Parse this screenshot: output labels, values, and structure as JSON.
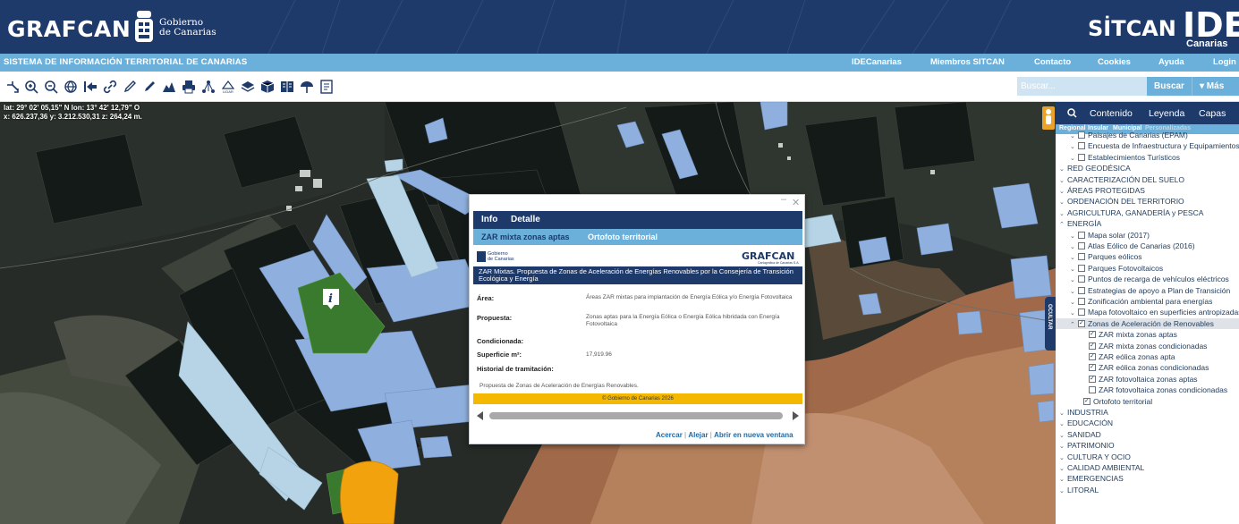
{
  "header": {
    "brand": "GRAFCAN",
    "gobierno": [
      "Gobierno",
      "de Canarias"
    ],
    "sitcan": "SİTCAN",
    "ide": "IDE",
    "ide_sub": "Canarias"
  },
  "navbar": {
    "system_title": "SISTEMA DE INFORMACIÓN TERRITORIAL DE CANARIAS",
    "links": [
      "IDECanarias",
      "Miembros SITCAN",
      "Contacto",
      "Cookies",
      "Ayuda",
      "Login"
    ]
  },
  "toolbar": {
    "icons": [
      "select-icon",
      "zoom-in-icon",
      "zoom-out-icon",
      "globe-icon",
      "back-icon",
      "link-icon",
      "pencil-icon",
      "ruler-icon",
      "profile-icon",
      "print-icon",
      "network-icon",
      "lidar-icon",
      "layers-icon",
      "3d-icon",
      "book-icon",
      "parachute-icon",
      "document-icon"
    ],
    "search_placeholder": "Buscar...",
    "search_button": "Buscar",
    "more_button": "▾ Más"
  },
  "map": {
    "coords_line1": "lat: 29° 02' 05,15\" N  lon: 13° 42' 12,79\" O",
    "coords_line2": "x: 626.237,36  y: 3.212.530,31  z: 264,24 m.",
    "ocultar": "OCULTAR"
  },
  "popup": {
    "tabs": [
      "Info",
      "Detalle"
    ],
    "sub_tabs": [
      "ZAR mixta zonas aptas",
      "Ortofoto territorial"
    ],
    "gob_small": [
      "Gobierno",
      "de Canarias"
    ],
    "grafcan": "GRAFCAN",
    "grafcan_sub": "Cartográfica de Canarias S.A.",
    "title": "ZAR Mixtas. Propuesta de Zonas de Aceleración de Energías Renovables por la Consejería de Transición Ecológica y Energía",
    "rows": [
      {
        "label": "Área:",
        "value": "Áreas ZAR mixtas para implantación de Energía Eólica y/o Energía Fotovoltaica"
      },
      {
        "label": "Propuesta:",
        "value": "Zonas aptas para la Energía Eólica o Energía Eólica hibridada con Energía Fotovoltaica"
      },
      {
        "label": "Condicionada:",
        "value": ""
      },
      {
        "label": "Superficie m²:",
        "value": "17,919.96"
      },
      {
        "label": "Historial de tramitación:",
        "value": ""
      }
    ],
    "historial_text": "Propuesta de Zonas de Aceleración de Energías Renovables.",
    "copyright": "© Gobierno de Canarias 2026",
    "links": [
      "Acercar",
      "Alejar",
      "Abrir en nueva ventana"
    ]
  },
  "sidebar": {
    "tabs": [
      "Contenido",
      "Leyenda",
      "Capas"
    ],
    "sub_tabs": [
      "Regional",
      "Insular",
      "Municipal",
      "Personalizadas"
    ],
    "tree": [
      {
        "label": "Paisajes de Canarias (EPAM)",
        "indent": 1,
        "cb": true,
        "on": false,
        "chev": "⌄"
      },
      {
        "label": "Encuesta de Infraestructura y Equipamientos",
        "indent": 1,
        "cb": true,
        "on": false,
        "chev": "⌄"
      },
      {
        "label": "Establecimientos Turísticos",
        "indent": 1,
        "cb": true,
        "on": false,
        "chev": "⌄"
      },
      {
        "label": "RED GEODÉSICA",
        "indent": 0,
        "cb": false,
        "on": false,
        "chev": "⌄"
      },
      {
        "label": "CARACTERIZACIÓN DEL SUELO",
        "indent": 0,
        "cb": false,
        "on": false,
        "chev": "⌄"
      },
      {
        "label": "ÁREAS PROTEGIDAS",
        "indent": 0,
        "cb": false,
        "on": false,
        "chev": "⌄"
      },
      {
        "label": "ORDENACIÓN DEL TERRITORIO",
        "indent": 0,
        "cb": false,
        "on": false,
        "chev": "⌄"
      },
      {
        "label": "AGRICULTURA, GANADERÍA y PESCA",
        "indent": 0,
        "cb": false,
        "on": false,
        "chev": "⌄"
      },
      {
        "label": "ENERGÍA",
        "indent": 0,
        "cb": false,
        "on": false,
        "chev": "^"
      },
      {
        "label": "Mapa solar (2017)",
        "indent": 1,
        "cb": true,
        "on": false,
        "chev": "⌄"
      },
      {
        "label": "Atlas Eólico de Canarias (2016)",
        "indent": 1,
        "cb": true,
        "on": false,
        "chev": "⌄"
      },
      {
        "label": "Parques eólicos",
        "indent": 1,
        "cb": true,
        "on": false,
        "chev": "⌄"
      },
      {
        "label": "Parques Fotovoltaicos",
        "indent": 1,
        "cb": true,
        "on": false,
        "chev": "⌄"
      },
      {
        "label": "Puntos de recarga de vehículos eléctricos",
        "indent": 1,
        "cb": true,
        "on": false,
        "chev": "⌄"
      },
      {
        "label": "Estrategias de apoyo a Plan de Transición",
        "indent": 1,
        "cb": true,
        "on": false,
        "chev": "⌄"
      },
      {
        "label": "Zonificación ambiental para energías",
        "indent": 1,
        "cb": true,
        "on": false,
        "chev": "⌄"
      },
      {
        "label": "Mapa fotovoltaico en superficies antropizadas",
        "indent": 1,
        "cb": true,
        "on": false,
        "chev": "⌄"
      },
      {
        "label": "Zonas de Aceleración de Renovables",
        "indent": 1,
        "cb": true,
        "on": true,
        "chev": "^",
        "sel": true
      },
      {
        "label": "ZAR mixta zonas aptas",
        "indent": 2,
        "cb": true,
        "on": true,
        "chev": ""
      },
      {
        "label": "ZAR mixta zonas condicionadas",
        "indent": 2,
        "cb": true,
        "on": true,
        "chev": ""
      },
      {
        "label": "ZAR eólica zonas apta",
        "indent": 2,
        "cb": true,
        "on": true,
        "chev": ""
      },
      {
        "label": "ZAR eólica zonas condicionadas",
        "indent": 2,
        "cb": true,
        "on": true,
        "chev": ""
      },
      {
        "label": "ZAR fotovoltaica zonas aptas",
        "indent": 2,
        "cb": true,
        "on": true,
        "chev": ""
      },
      {
        "label": "ZAR fotovoltaica zonas condicionadas",
        "indent": 2,
        "cb": true,
        "on": false,
        "chev": ""
      },
      {
        "label": "Ortofoto territorial",
        "indent": 1.5,
        "cb": true,
        "on": true,
        "chev": ""
      },
      {
        "label": "INDUSTRIA",
        "indent": 0,
        "cb": false,
        "on": false,
        "chev": "⌄"
      },
      {
        "label": "EDUCACIÓN",
        "indent": 0,
        "cb": false,
        "on": false,
        "chev": "⌄"
      },
      {
        "label": "SANIDAD",
        "indent": 0,
        "cb": false,
        "on": false,
        "chev": "⌄"
      },
      {
        "label": "PATRIMONIO",
        "indent": 0,
        "cb": false,
        "on": false,
        "chev": "⌄"
      },
      {
        "label": "CULTURA Y OCIO",
        "indent": 0,
        "cb": false,
        "on": false,
        "chev": "⌄"
      },
      {
        "label": "CALIDAD AMBIENTAL",
        "indent": 0,
        "cb": false,
        "on": false,
        "chev": "⌄"
      },
      {
        "label": "EMERGENCIAS",
        "indent": 0,
        "cb": false,
        "on": false,
        "chev": "⌄"
      },
      {
        "label": "LITORAL",
        "indent": 0,
        "cb": false,
        "on": false,
        "chev": "⌄"
      }
    ]
  },
  "colors": {
    "header_bg": "#1e3a6a",
    "nav_bg": "#6ab0db",
    "zar_mixta_apta": "#8fb0de",
    "zar_condicionada": "#b6d4e6",
    "zar_eolica": "#3a7a2e",
    "zar_fotovoltaica": "#f2a20c"
  }
}
